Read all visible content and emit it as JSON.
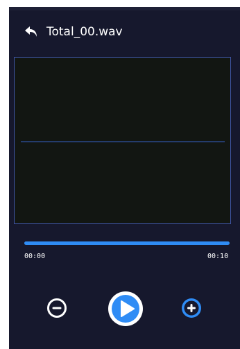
{
  "header": {
    "back_icon": "back-arrow-icon",
    "title": "Total_00.wav"
  },
  "player": {
    "progress": 1.0,
    "time_start": "00:00",
    "time_end": "00:10"
  },
  "controls": {
    "zoom_out_icon": "minus-circle-icon",
    "play_icon": "play-circle-icon",
    "zoom_in_icon": "plus-circle-icon"
  },
  "colors": {
    "background": "#16182d",
    "accent": "#2f8cf5",
    "waveform_bg": "#121612",
    "waveform_border": "#3f55a6"
  }
}
